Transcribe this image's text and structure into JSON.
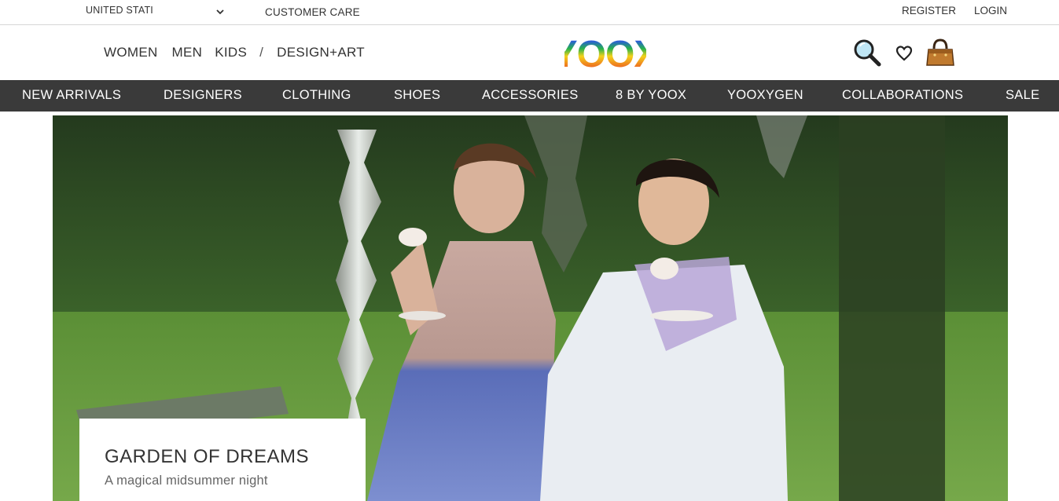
{
  "topbar": {
    "country": "UNITED STATI",
    "customer_care": "CUSTOMER CARE",
    "register": "REGISTER",
    "login": "LOGIN"
  },
  "header": {
    "gender_nav": [
      "WOMEN",
      "MEN",
      "KIDS",
      "/",
      "DESIGN+ART"
    ],
    "logo_text": "YOOX",
    "icons": [
      "search-icon",
      "heart-icon",
      "shopping-bag-icon"
    ]
  },
  "categories": [
    "NEW ARRIVALS",
    "DESIGNERS",
    "CLOTHING",
    "SHOES",
    "ACCESSORIES",
    "8 BY YOOX",
    "YOOXYGEN",
    "COLLABORATIONS",
    "SALE"
  ],
  "hero": {
    "title": "GARDEN OF DREAMS",
    "subtitle": "A magical midsummer night"
  },
  "colors": {
    "category_bar": "#3a3a3a",
    "text": "#333333"
  }
}
